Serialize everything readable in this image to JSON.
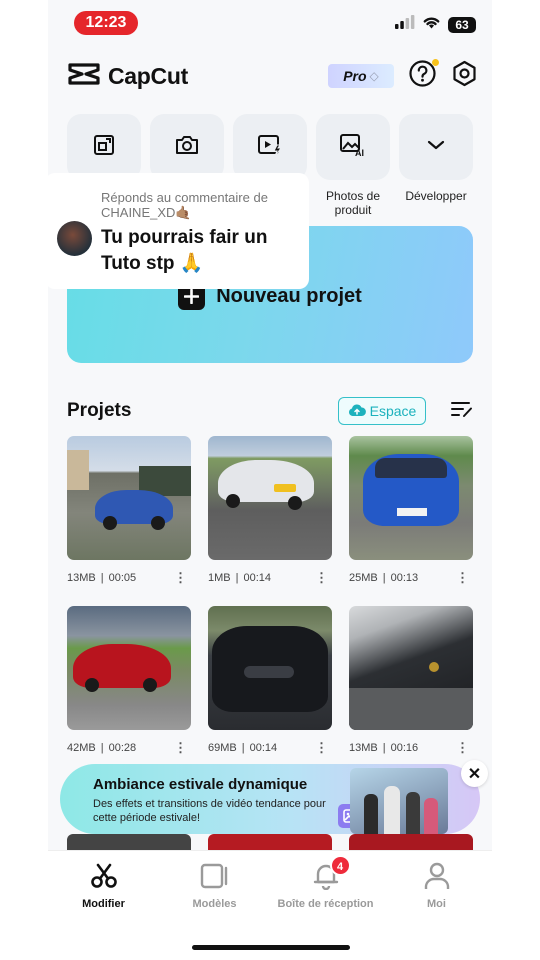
{
  "status": {
    "time": "12:23",
    "battery": "63"
  },
  "header": {
    "brand": "CapCut",
    "pro_label": "Pro"
  },
  "tools": [
    {
      "label": "",
      "icon": "resize-icon"
    },
    {
      "label": "",
      "icon": "camera-icon"
    },
    {
      "label": "",
      "icon": "autocut-icon"
    },
    {
      "label": "Photos de produit",
      "icon": "ai-photo-icon"
    },
    {
      "label": "Développer",
      "icon": "chevron-down-icon"
    }
  ],
  "comment": {
    "reply_to": "Réponds au commentaire de CHAINE_XD🤙🏽",
    "message": "Tu pourrais fair un Tuto stp 🙏"
  },
  "new_project": {
    "label": "Nouveau projet"
  },
  "projects": {
    "title": "Projets",
    "espace_label": "Espace",
    "items": [
      {
        "size": "13MB",
        "duration": "00:05"
      },
      {
        "size": "1MB",
        "duration": "00:14"
      },
      {
        "size": "25MB",
        "duration": "00:13"
      },
      {
        "size": "42MB",
        "duration": "00:28"
      },
      {
        "size": "69MB",
        "duration": "00:14"
      },
      {
        "size": "13MB",
        "duration": "00:16"
      }
    ]
  },
  "promo": {
    "title": "Ambiance estivale dynamique",
    "subtitle": "Des effets et transitions de vidéo tendance pour cette période estivale!",
    "close": "✕"
  },
  "tabbar": {
    "tabs": [
      {
        "label": "Modifier",
        "active": true
      },
      {
        "label": "Modèles",
        "active": false
      },
      {
        "label": "Boîte de réception",
        "active": false,
        "badge": "4"
      },
      {
        "label": "Moi",
        "active": false
      }
    ]
  },
  "colors": {
    "accent": "#35c0c9",
    "badge": "#ee2b3b",
    "time_pill": "#e5262b"
  }
}
